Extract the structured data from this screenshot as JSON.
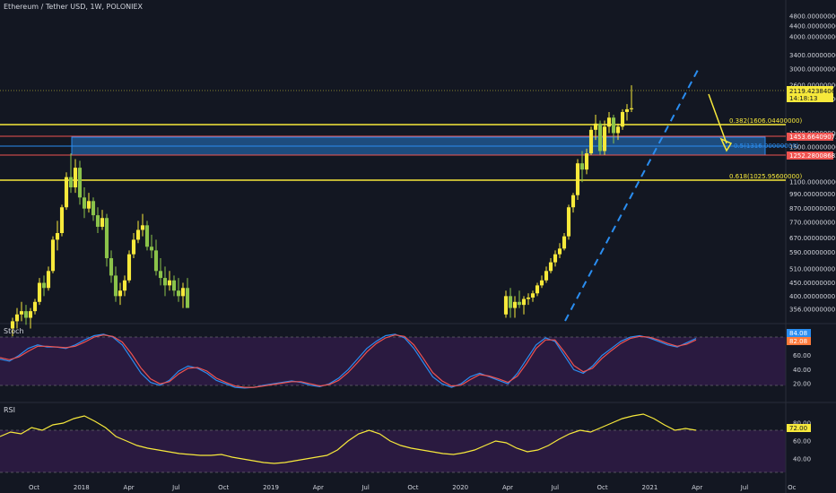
{
  "header": {
    "title": "Ethereum / Tether USD, 1W, POLONIEX"
  },
  "panes": {
    "stoch_label": "Stoch",
    "rsi_label": "RSI"
  },
  "price_axis": {
    "ticks": [
      "4800.00000000",
      "4400.00000000",
      "4000.00000000",
      "3400.00000000",
      "3000.00000000",
      "2600.00000000",
      "2300.00000000",
      "1700.00000000",
      "1500.00000000",
      "1100.00000000",
      "990.00000000",
      "870.00000000",
      "770.00000000",
      "670.00000000",
      "590.00000000",
      "510.00000000",
      "450.00000000",
      "400.00000000",
      "356.00000000"
    ],
    "last_price": "2119.42384065",
    "countdown": "14:18:13",
    "level_1": "1453.66409072",
    "level_2": "1252.28008682"
  },
  "fib_levels": [
    {
      "label": "0.382(1606.04400000)",
      "color": "#f7e93b"
    },
    {
      "label": "0.5(1316.00000000)",
      "color": "#2a8df0"
    },
    {
      "label": "0.618(1025.95600000)",
      "color": "#f7e93b"
    }
  ],
  "stoch_axis": {
    "ticks": [
      "60.00",
      "40.00",
      "20.00"
    ],
    "k_value": "84.08",
    "d_value": "82.08"
  },
  "rsi_axis": {
    "ticks": [
      "80.00",
      "60.00",
      "40.00"
    ],
    "value": "72.00"
  },
  "time_axis": {
    "ticks": [
      "Oct",
      "2018",
      "Apr",
      "Jul",
      "Oct",
      "2019",
      "Apr",
      "Jul",
      "Oct",
      "2020",
      "Apr",
      "Jul",
      "Oct",
      "2021",
      "Apr",
      "Jul",
      "Oc"
    ]
  },
  "colors": {
    "bull": "#f7e93b",
    "bear": "#f7e93b",
    "bull_green": "#26a69a",
    "stoch_k": "#2a8df0",
    "stoch_d": "#ef5350",
    "rsi": "#f7e93b",
    "box": "#2a8df0",
    "pane_fill": "#2a1a40"
  },
  "chart_data": [
    {
      "type": "candlestick",
      "title": "Ethereum / Tether USD, 1W, POLONIEX",
      "y_scale": "log",
      "ylim": [
        356,
        4800
      ],
      "x_ticks": [
        "Oct",
        "2018",
        "Apr",
        "Jul",
        "Oct",
        "2019",
        "Apr",
        "Jul",
        "Oct",
        "2020",
        "Apr",
        "Jul",
        "Oct",
        "2021",
        "Apr",
        "Jul",
        "Oc"
      ],
      "last_close": 2119.42,
      "horizontal_levels": [
        1606.044,
        1453.664,
        1316.0,
        1252.28,
        1025.956
      ],
      "fib_retracement": {
        "0.382": 1606.044,
        "0.5": 1316.0,
        "0.618": 1025.956
      },
      "highlight_zone": [
        1252.28,
        1453.66
      ],
      "candles": [
        [
          0,
          300,
          330,
          280,
          320
        ],
        [
          1,
          320,
          360,
          300,
          340
        ],
        [
          2,
          340,
          380,
          320,
          350
        ],
        [
          3,
          350,
          370,
          310,
          330
        ],
        [
          4,
          330,
          360,
          300,
          350
        ],
        [
          5,
          350,
          390,
          340,
          380
        ],
        [
          6,
          380,
          470,
          370,
          450
        ],
        [
          7,
          450,
          480,
          400,
          430
        ],
        [
          8,
          430,
          520,
          420,
          500
        ],
        [
          9,
          500,
          680,
          490,
          660
        ],
        [
          10,
          660,
          780,
          600,
          700
        ],
        [
          11,
          700,
          900,
          680,
          880
        ],
        [
          12,
          880,
          1200,
          860,
          1150
        ],
        [
          13,
          1150,
          1420,
          1000,
          1050
        ],
        [
          14,
          1050,
          1350,
          1000,
          1250
        ],
        [
          15,
          1250,
          1330,
          900,
          960
        ],
        [
          16,
          960,
          1050,
          800,
          870
        ],
        [
          17,
          870,
          1000,
          840,
          930
        ],
        [
          18,
          930,
          960,
          780,
          820
        ],
        [
          19,
          820,
          880,
          700,
          740
        ],
        [
          20,
          740,
          860,
          720,
          800
        ],
        [
          21,
          800,
          830,
          520,
          560
        ],
        [
          22,
          560,
          600,
          450,
          480
        ],
        [
          23,
          480,
          520,
          380,
          400
        ],
        [
          24,
          400,
          450,
          370,
          420
        ],
        [
          25,
          420,
          480,
          400,
          460
        ],
        [
          26,
          460,
          600,
          450,
          580
        ],
        [
          27,
          580,
          700,
          560,
          660
        ],
        [
          28,
          660,
          780,
          640,
          720
        ],
        [
          29,
          720,
          830,
          680,
          750
        ],
        [
          30,
          750,
          780,
          600,
          620
        ],
        [
          31,
          620,
          690,
          560,
          600
        ],
        [
          32,
          600,
          660,
          480,
          500
        ],
        [
          33,
          500,
          560,
          440,
          470
        ],
        [
          34,
          470,
          520,
          400,
          440
        ],
        [
          35,
          440,
          500,
          420,
          460
        ],
        [
          36,
          460,
          480,
          400,
          420
        ],
        [
          37,
          420,
          470,
          380,
          400
        ],
        [
          38,
          400,
          450,
          360,
          430
        ],
        [
          39,
          430,
          470,
          380,
          360
        ],
        [
          110,
          340,
          420,
          330,
          400
        ],
        [
          111,
          400,
          430,
          330,
          360
        ],
        [
          112,
          360,
          400,
          330,
          380
        ],
        [
          113,
          380,
          420,
          360,
          370
        ],
        [
          114,
          370,
          400,
          340,
          390
        ],
        [
          115,
          390,
          410,
          370,
          395
        ],
        [
          116,
          395,
          420,
          380,
          410
        ],
        [
          117,
          410,
          450,
          400,
          440
        ],
        [
          118,
          440,
          480,
          430,
          460
        ],
        [
          119,
          460,
          520,
          450,
          500
        ],
        [
          120,
          500,
          560,
          490,
          540
        ],
        [
          121,
          540,
          600,
          520,
          580
        ],
        [
          122,
          580,
          640,
          560,
          610
        ],
        [
          123,
          610,
          700,
          600,
          680
        ],
        [
          124,
          680,
          900,
          660,
          880
        ],
        [
          125,
          880,
          1000,
          840,
          980
        ],
        [
          126,
          980,
          1350,
          940,
          1300
        ],
        [
          127,
          1300,
          1450,
          1100,
          1230
        ],
        [
          128,
          1230,
          1480,
          1180,
          1420
        ],
        [
          129,
          1420,
          1800,
          1400,
          1750
        ],
        [
          130,
          1750,
          2000,
          1600,
          1850
        ],
        [
          131,
          1850,
          1900,
          1400,
          1450
        ],
        [
          132,
          1450,
          1900,
          1400,
          1800
        ],
        [
          133,
          1800,
          2050,
          1700,
          1950
        ],
        [
          134,
          1950,
          2000,
          1550,
          1700
        ],
        [
          135,
          1700,
          1850,
          1600,
          1800
        ],
        [
          136,
          1800,
          2100,
          1750,
          2050
        ],
        [
          137,
          2050,
          2200,
          1900,
          2100
        ],
        [
          138,
          2100,
          2600,
          2050,
          2119
        ]
      ]
    },
    {
      "type": "line",
      "title": "Stoch",
      "ylim": [
        0,
        100
      ],
      "series": [
        {
          "name": "84.08",
          "values": [
            55,
            52,
            60,
            70,
            75,
            72,
            72,
            70,
            75,
            82,
            88,
            90,
            86,
            75,
            55,
            35,
            22,
            18,
            25,
            38,
            45,
            42,
            35,
            25,
            20,
            15,
            14,
            15,
            18,
            20,
            22,
            24,
            22,
            18,
            16,
            20,
            28,
            40,
            55,
            70,
            80,
            88,
            90,
            85,
            70,
            50,
            30,
            20,
            15,
            20,
            30,
            35,
            30,
            25,
            20,
            35,
            55,
            75,
            85,
            80,
            60,
            40,
            35,
            45,
            60,
            70,
            80,
            86,
            88,
            85,
            80,
            75,
            72,
            78,
            84
          ]
        },
        {
          "name": "82.08",
          "values": [
            57,
            54,
            58,
            66,
            73,
            73,
            72,
            71,
            73,
            79,
            86,
            89,
            87,
            79,
            62,
            42,
            27,
            20,
            23,
            34,
            42,
            43,
            38,
            28,
            22,
            17,
            15,
            15,
            17,
            19,
            21,
            23,
            23,
            20,
            17,
            19,
            25,
            36,
            50,
            65,
            77,
            85,
            89,
            87,
            75,
            56,
            36,
            24,
            17,
            18,
            26,
            33,
            31,
            27,
            22,
            31,
            49,
            70,
            82,
            82,
            65,
            46,
            37,
            42,
            56,
            67,
            77,
            84,
            87,
            86,
            82,
            77,
            73,
            76,
            82
          ]
        }
      ]
    },
    {
      "type": "line",
      "title": "RSI",
      "ylim": [
        20,
        100
      ],
      "series": [
        {
          "name": "72.00",
          "values": [
            65,
            70,
            68,
            75,
            72,
            78,
            80,
            85,
            88,
            82,
            75,
            65,
            60,
            55,
            52,
            50,
            48,
            46,
            45,
            44,
            44,
            45,
            42,
            40,
            38,
            36,
            35,
            36,
            38,
            40,
            42,
            44,
            50,
            60,
            68,
            72,
            68,
            60,
            55,
            52,
            50,
            48,
            46,
            45,
            47,
            50,
            55,
            60,
            58,
            52,
            48,
            50,
            55,
            62,
            68,
            72,
            70,
            75,
            80,
            85,
            88,
            90,
            85,
            78,
            72,
            74,
            72
          ]
        }
      ]
    }
  ]
}
